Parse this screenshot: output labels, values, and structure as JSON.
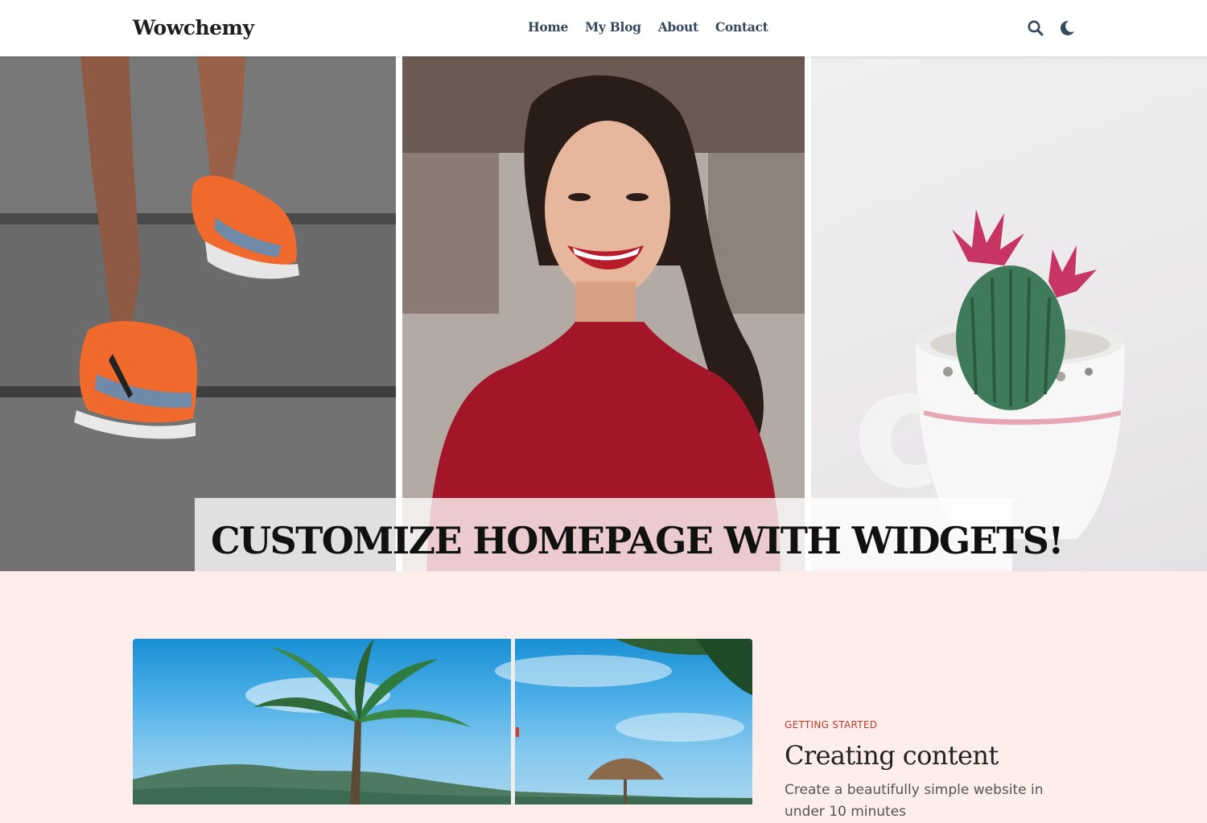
{
  "site": {
    "brand": "Wowchemy"
  },
  "nav": {
    "links": [
      {
        "label": "Home"
      },
      {
        "label": "My Blog"
      },
      {
        "label": "About"
      },
      {
        "label": "Contact"
      }
    ],
    "icons": [
      "search-icon",
      "moon-icon"
    ],
    "text_color": "#34495e"
  },
  "hero": {
    "title": "CUSTOMIZE HOMEPAGE WITH WIDGETS!",
    "images": [
      "running-shoes-stairs",
      "smiling-woman",
      "cactus-in-mug"
    ]
  },
  "featured_post": {
    "category": "GETTING STARTED",
    "title": "Creating content",
    "summary": "Create a beautifully simple website in under 10 minutes",
    "image": "tropical-beach-palms",
    "accent_color": "#c0392b"
  },
  "colors": {
    "page_background": "#fdeeec",
    "navbar_background": "#ffffff"
  }
}
